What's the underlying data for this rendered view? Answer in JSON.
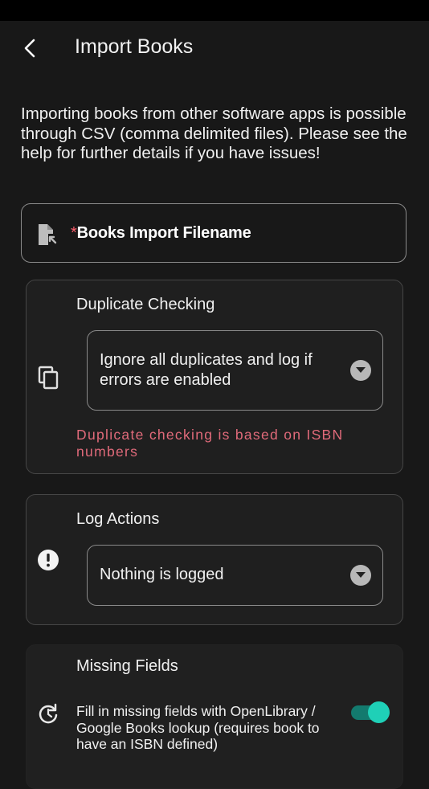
{
  "header": {
    "title": "Import Books",
    "back_icon": "back-arrow-icon"
  },
  "intro_text": "Importing books from other software apps is possible through CSV (comma delimited files). Please see the help for further details if you have issues!",
  "file_field": {
    "required_mark": "*",
    "label": "Books Import Filename",
    "icon": "file-import-icon"
  },
  "duplicate": {
    "title": "Duplicate Checking",
    "icon": "copy-icon",
    "selected": "Ignore all duplicates and log if errors are enabled",
    "helper": "Duplicate checking is based on ISBN numbers"
  },
  "log": {
    "title": "Log Actions",
    "icon": "alert-circle-icon",
    "selected": "Nothing is logged"
  },
  "missing": {
    "title": "Missing Fields",
    "icon": "refresh-icon",
    "toggle_label": "Fill in missing fields with OpenLibrary / Google Books lookup (requires book to have an ISBN defined)",
    "toggle_on": true
  },
  "colors": {
    "accent": "#1fd0b7",
    "error": "#e06a7a",
    "background": "#181818"
  }
}
